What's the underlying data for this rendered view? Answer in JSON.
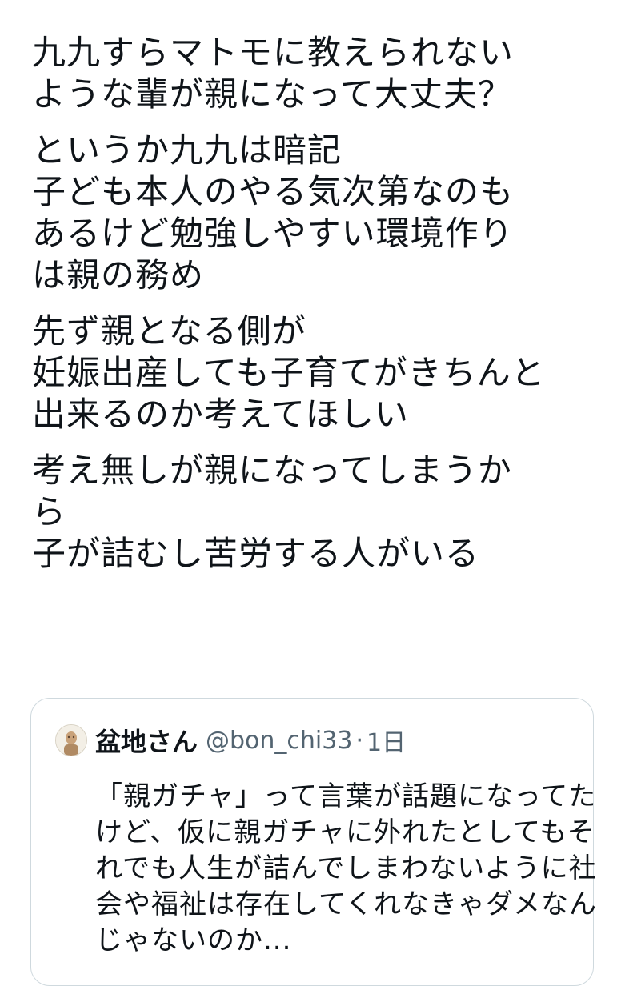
{
  "tweet": {
    "paragraphs": [
      [
        "九九すらマトモに教えられない",
        "ような輩が親になって大丈夫？"
      ],
      [
        "というか九九は暗記",
        "子ども本人のやる気次第なのも",
        "あるけど勉強しやすい環境作り",
        "は親の務め"
      ],
      [
        "先ず親となる側が",
        "妊娠出産しても子育てがきちんと",
        "出来るのか考えてほしい"
      ],
      [
        "考え無しが親になってしまうか",
        "ら",
        "子が詰むし苦労する人がいる"
      ]
    ]
  },
  "quoted_tweet": {
    "avatar_icon": "user-avatar-icon",
    "display_name": "盆地さん",
    "handle": "@bon_chi33",
    "separator": "·",
    "time": "1日",
    "lines": [
      "「親ガチャ」って言葉が話題になってた",
      "けど、仮に親ガチャに外れたとしてもそ",
      "れでも人生が詰んでしまわないように社",
      "会や福祉は存在してくれなきゃダメなん",
      "じゃないのか..."
    ]
  },
  "colors": {
    "text": "#0f1419",
    "secondary": "#536471",
    "border": "#cfd9de",
    "background": "#ffffff"
  }
}
